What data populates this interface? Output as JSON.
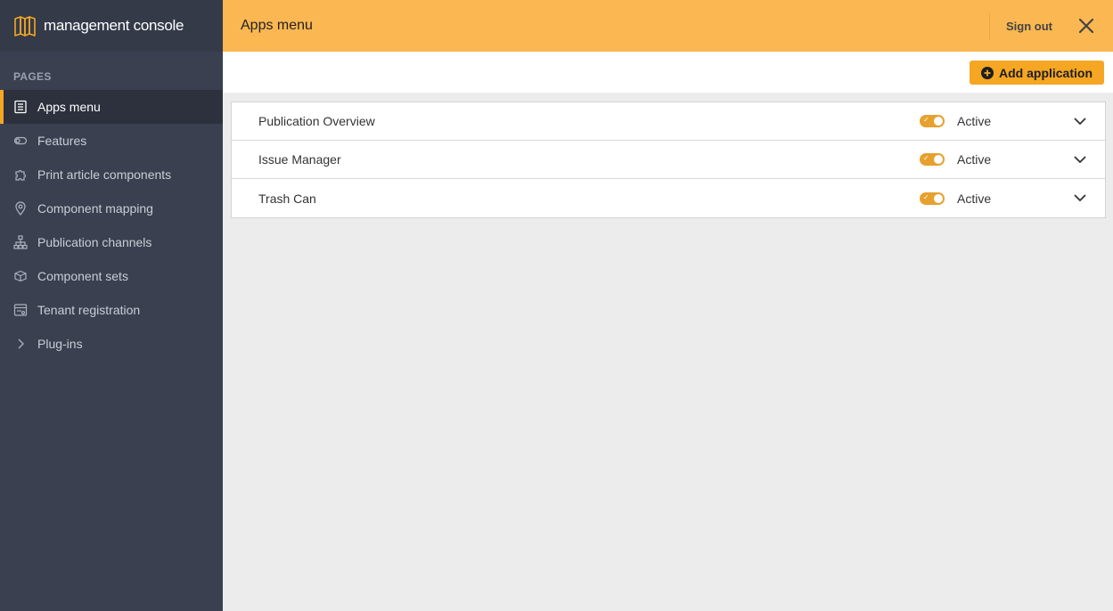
{
  "brand": {
    "name": "management console",
    "icon": "map-icon"
  },
  "sidebar": {
    "section_label": "PAGES",
    "items": [
      {
        "label": "Apps menu",
        "icon": "list-icon",
        "active": true
      },
      {
        "label": "Features",
        "icon": "toggle-icon",
        "active": false
      },
      {
        "label": "Print article components",
        "icon": "puzzle-icon",
        "active": false
      },
      {
        "label": "Component mapping",
        "icon": "location-pin-icon",
        "active": false
      },
      {
        "label": "Publication channels",
        "icon": "sitemap-icon",
        "active": false
      },
      {
        "label": "Component sets",
        "icon": "box-icon",
        "active": false
      },
      {
        "label": "Tenant registration",
        "icon": "form-icon",
        "active": false
      },
      {
        "label": "Plug-ins",
        "icon": "chevron-right-icon",
        "active": false
      }
    ]
  },
  "header": {
    "title": "Apps menu",
    "signout_label": "Sign out",
    "close_icon": "close-icon"
  },
  "toolbar": {
    "add_label": "Add application",
    "add_icon": "plus-circle-icon"
  },
  "apps": [
    {
      "name": "Publication Overview",
      "status": "Active",
      "enabled": true
    },
    {
      "name": "Issue Manager",
      "status": "Active",
      "enabled": true
    },
    {
      "name": "Trash Can",
      "status": "Active",
      "enabled": true
    }
  ],
  "colors": {
    "accent": "#fbb752",
    "button": "#f5a623",
    "sidebar_bg": "#3a4050",
    "toggle_on": "#e6a12e"
  }
}
